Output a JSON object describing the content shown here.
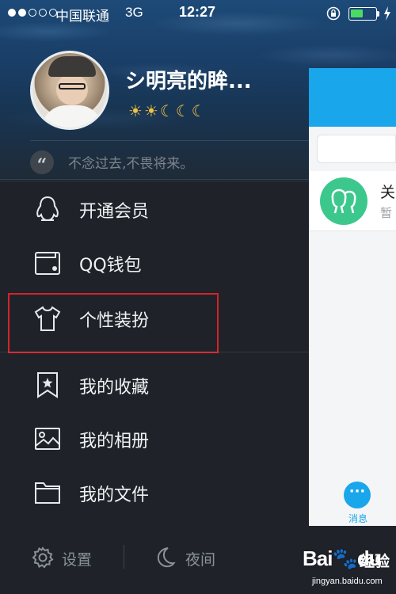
{
  "status_bar": {
    "carrier": "中国联通",
    "network": "3G",
    "time": "12:27",
    "signal_bars_filled": 2,
    "signal_bars_total": 5,
    "battery_level": 0.5
  },
  "profile": {
    "username": "シ明亮的眸...",
    "level_icons": [
      "sun",
      "sun",
      "moon",
      "moon",
      "moon"
    ],
    "signature": "不念过去,不畏将来。"
  },
  "menu": {
    "items": [
      {
        "label": "开通会员",
        "icon": "penguin-icon"
      },
      {
        "label": "QQ钱包",
        "icon": "wallet-icon"
      },
      {
        "label": "个性装扮",
        "icon": "tshirt-icon"
      },
      {
        "label": "我的收藏",
        "icon": "bookmark-star-icon"
      },
      {
        "label": "我的相册",
        "icon": "photo-icon"
      },
      {
        "label": "我的文件",
        "icon": "folder-icon"
      }
    ]
  },
  "bottom_bar": {
    "settings_label": "设置",
    "night_label": "夜间"
  },
  "peek_panel": {
    "row_title": "关",
    "row_subtitle": "暂",
    "tab_label": "消息"
  },
  "watermark": {
    "logo": "Bai🐾du",
    "brand": "经验",
    "url": "jingyan.baidu.com"
  },
  "colors": {
    "accent": "#19a6ea",
    "highlight_box": "#d3232a",
    "panel_bg": "#1f2329",
    "battery": "#4cd964"
  }
}
